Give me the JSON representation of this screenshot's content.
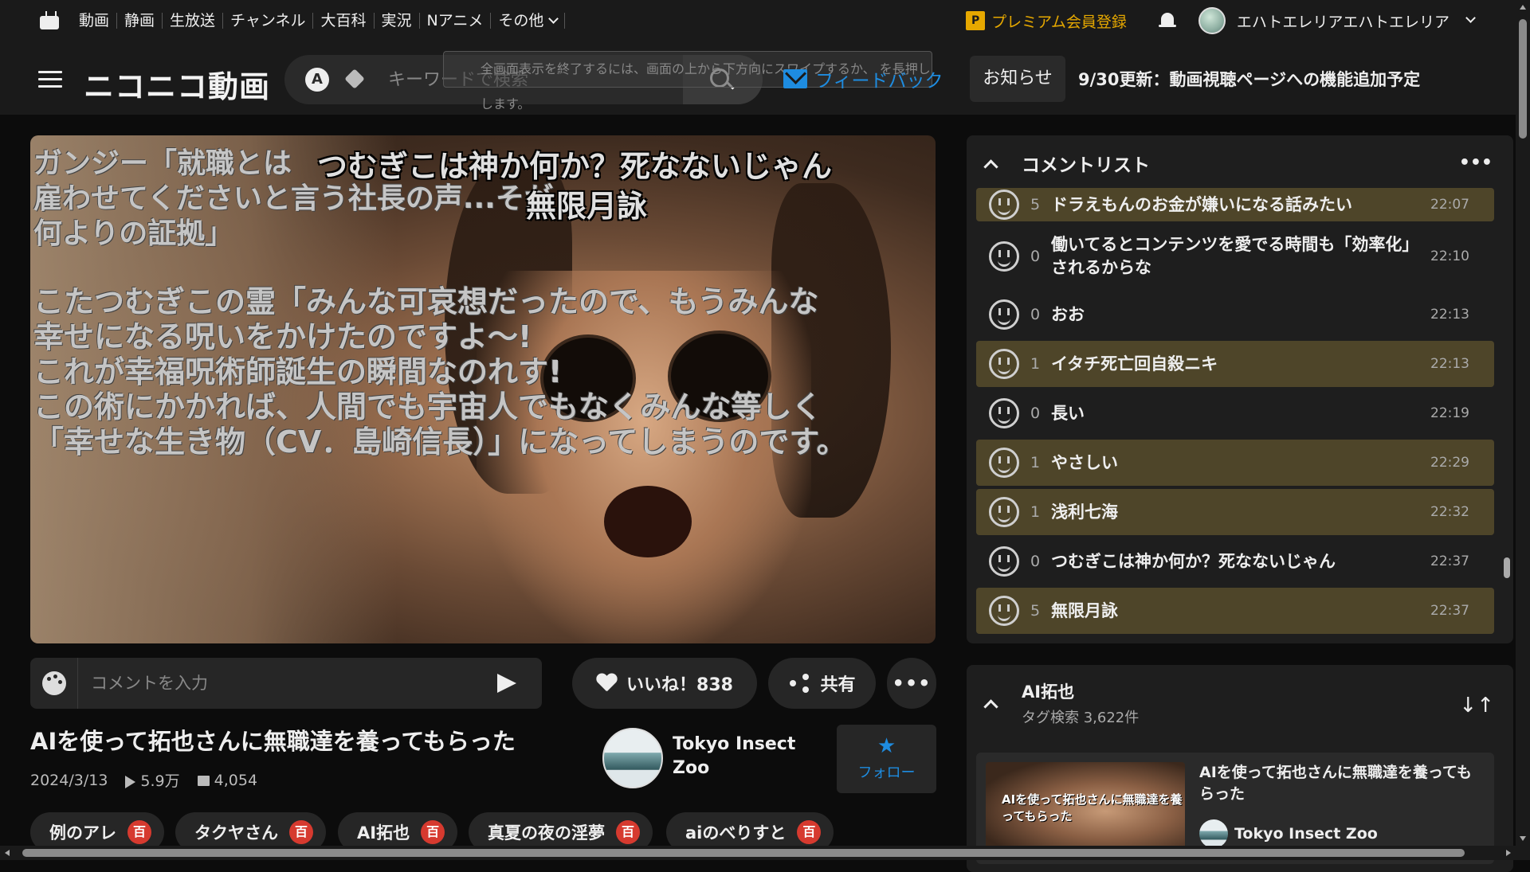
{
  "topnav": {
    "items": [
      "動画",
      "静画",
      "生放送",
      "チャンネル",
      "大百科",
      "実況",
      "Nアニメ",
      "その他"
    ],
    "premium_label": "プレミアム会員登録",
    "premium_badge": "P",
    "user_name": "エハトエレリアエハトエレリア"
  },
  "header": {
    "logo_text": "ニコニコ動画",
    "search_mode_letter": "A",
    "search_placeholder": "キーワードで検索",
    "fullscreen_toast": "全画面表示を終了するには、画面の上から下方向にスワイプするか、   を長押しします。",
    "feedback_label": "フィードバック",
    "notice_button": "お知らせ",
    "notice_text": "9/30更新：動画視聴ページへの機能追加予定"
  },
  "video": {
    "overlay_lines_faint": [
      "ガンジー「就職とは",
      "雇わせてくださいと言う社長の声...そが",
      "何よりの証拠」"
    ],
    "overlay_top_1": "つむぎこは神か何か？死なないじゃん",
    "overlay_top_2": "無限月詠",
    "overlay_main": [
      "こたつむぎこの霊「みんな可哀想だったので、もうみんな",
      "幸せになる呪いをかけたのですよ〜!",
      "これが幸福呪術師誕生の瞬間なのれす!",
      "この術にかかれば、人間でも宇宙人でもなくみんな等しく",
      "「幸せな生き物（CV．島崎信長）」になってしまうのです。"
    ]
  },
  "controls": {
    "comment_placeholder": "コメントを入力",
    "like_label": "いいね！838",
    "share_label": "共有",
    "more_label": "•••"
  },
  "info": {
    "title": "AIを使って拓也さんに無職達を養ってもらった",
    "date": "2024/3/13",
    "views": "5.9万",
    "comments": "4,054",
    "owner_name": "Tokyo Insect Zoo",
    "follow_label": "フォロー",
    "follow_icon": "★"
  },
  "tags": [
    {
      "label": "例のアレ",
      "badge": "百"
    },
    {
      "label": "タクヤさん",
      "badge": "百"
    },
    {
      "label": "AI拓也",
      "badge": "百"
    },
    {
      "label": "真夏の夜の淫夢",
      "badge": "百"
    },
    {
      "label": "aiのべりすと",
      "badge": "百"
    }
  ],
  "comment_list": {
    "title": "コメントリスト",
    "menu": "•••",
    "rows": [
      {
        "count": "5",
        "text": "ドラえもんのお金が嫌いになる話みたい",
        "time": "22:07",
        "highlight": true
      },
      {
        "count": "0",
        "text": "働いてるとコンテンツを愛でる時間も「効率化」されるからな",
        "time": "22:10",
        "highlight": false
      },
      {
        "count": "0",
        "text": "おお",
        "time": "22:13",
        "highlight": false
      },
      {
        "count": "1",
        "text": "イタチ死亡回自殺ニキ",
        "time": "22:13",
        "highlight": true
      },
      {
        "count": "0",
        "text": "長い",
        "time": "22:19",
        "highlight": false
      },
      {
        "count": "1",
        "text": "やさしい",
        "time": "22:29",
        "highlight": true
      },
      {
        "count": "1",
        "text": "浅利七海",
        "time": "22:32",
        "highlight": true
      },
      {
        "count": "0",
        "text": "つむぎこは神か何か？死なないじゃん",
        "time": "22:37",
        "highlight": false
      },
      {
        "count": "5",
        "text": "無限月詠",
        "time": "22:37",
        "highlight": true
      }
    ]
  },
  "tag_panel": {
    "title": "AI拓也",
    "subtitle": "タグ検索 3,622件",
    "sort_icon": "↓↑",
    "card": {
      "thumb_text": "AIを使って拓也さんに無職達を養ってもらった",
      "title": "AIを使って拓也さんに無職達を養ってもらった",
      "owner": "Tokyo Insect Zoo"
    }
  },
  "colors": {
    "accent_blue": "#1e8ce0",
    "premium_gold": "#e6a800",
    "highlight_row": "#4e4529",
    "dic_badge_red": "#d63a2f"
  }
}
